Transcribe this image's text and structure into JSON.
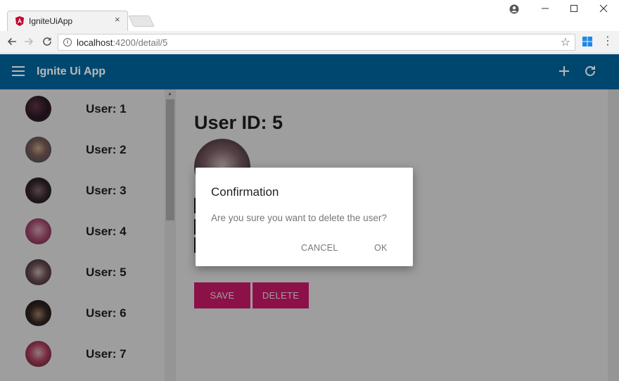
{
  "browser": {
    "tab_title": "IgniteUiApp",
    "tab_close": "×",
    "url_host": "localhost",
    "url_rest": ":4200/detail/5"
  },
  "app": {
    "title": "Ignite Ui App"
  },
  "users": [
    {
      "label": "User: 1"
    },
    {
      "label": "User: 2"
    },
    {
      "label": "User: 3"
    },
    {
      "label": "User: 4"
    },
    {
      "label": "User: 5"
    },
    {
      "label": "User: 6"
    },
    {
      "label": "User: 7"
    }
  ],
  "detail": {
    "title": "User ID: 5",
    "save_label": "SAVE",
    "delete_label": "DELETE"
  },
  "dialog": {
    "title": "Confirmation",
    "message": "Are you sure you want to delete the user?",
    "cancel_label": "CANCEL",
    "ok_label": "OK"
  },
  "colors": {
    "appbar": "#00639c",
    "accent": "#e41c77"
  },
  "icons": [
    "angular-favicon",
    "info-icon",
    "star-icon",
    "windows-icon",
    "more-vert-icon",
    "menu-icon",
    "add-icon",
    "refresh-icon"
  ]
}
